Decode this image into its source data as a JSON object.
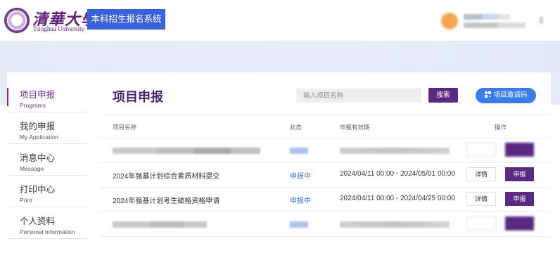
{
  "header": {
    "logo_cn": "清華大學",
    "logo_en": "Tsinghua University",
    "system_name": "本科招生报名系统"
  },
  "sidebar": {
    "items": [
      {
        "cn": "项目申报",
        "en": "Programs",
        "active": true
      },
      {
        "cn": "我的申报",
        "en": "My Application",
        "active": false
      },
      {
        "cn": "消息中心",
        "en": "Message",
        "active": false
      },
      {
        "cn": "打印中心",
        "en": "Print",
        "active": false
      },
      {
        "cn": "个人资料",
        "en": "Personal Information",
        "active": false
      }
    ]
  },
  "main": {
    "title": "项目申报",
    "search": {
      "placeholder": "输入项目名称",
      "value": ""
    },
    "search_button": "搜索",
    "invite_button": "项目邀请码",
    "table": {
      "headers": {
        "name": "项目名称",
        "status": "状态",
        "period": "申报有效期",
        "actions": "操作"
      },
      "rows": [
        {
          "name": "",
          "status": "",
          "period": "",
          "detail": "",
          "apply": "",
          "blurred": true
        },
        {
          "name": "2024年强基计划综合素质材料提交",
          "status": "申报中",
          "period": "2024/04/11 00:00 - 2024/05/01 00:00",
          "detail": "详情",
          "apply": "申报",
          "blurred": false
        },
        {
          "name": "2024年强基计划考生破格资格申请",
          "status": "申报中",
          "period": "2024/04/11 00:00 - 2024/04/25 00:00",
          "detail": "详情",
          "apply": "申报",
          "blurred": false
        },
        {
          "name": "",
          "status": "",
          "period": "",
          "detail": "",
          "apply": "",
          "blurred": true
        }
      ]
    }
  },
  "colors": {
    "brand_purple": "#5a2a82",
    "badge_blue": "#3a63d6",
    "status_blue": "#3a72d8",
    "invite_blue": "#3d7be8",
    "banner": "#e6ebf8"
  },
  "icons": {
    "invite": "qr-code-icon",
    "logo": "tsinghua-seal-icon"
  }
}
